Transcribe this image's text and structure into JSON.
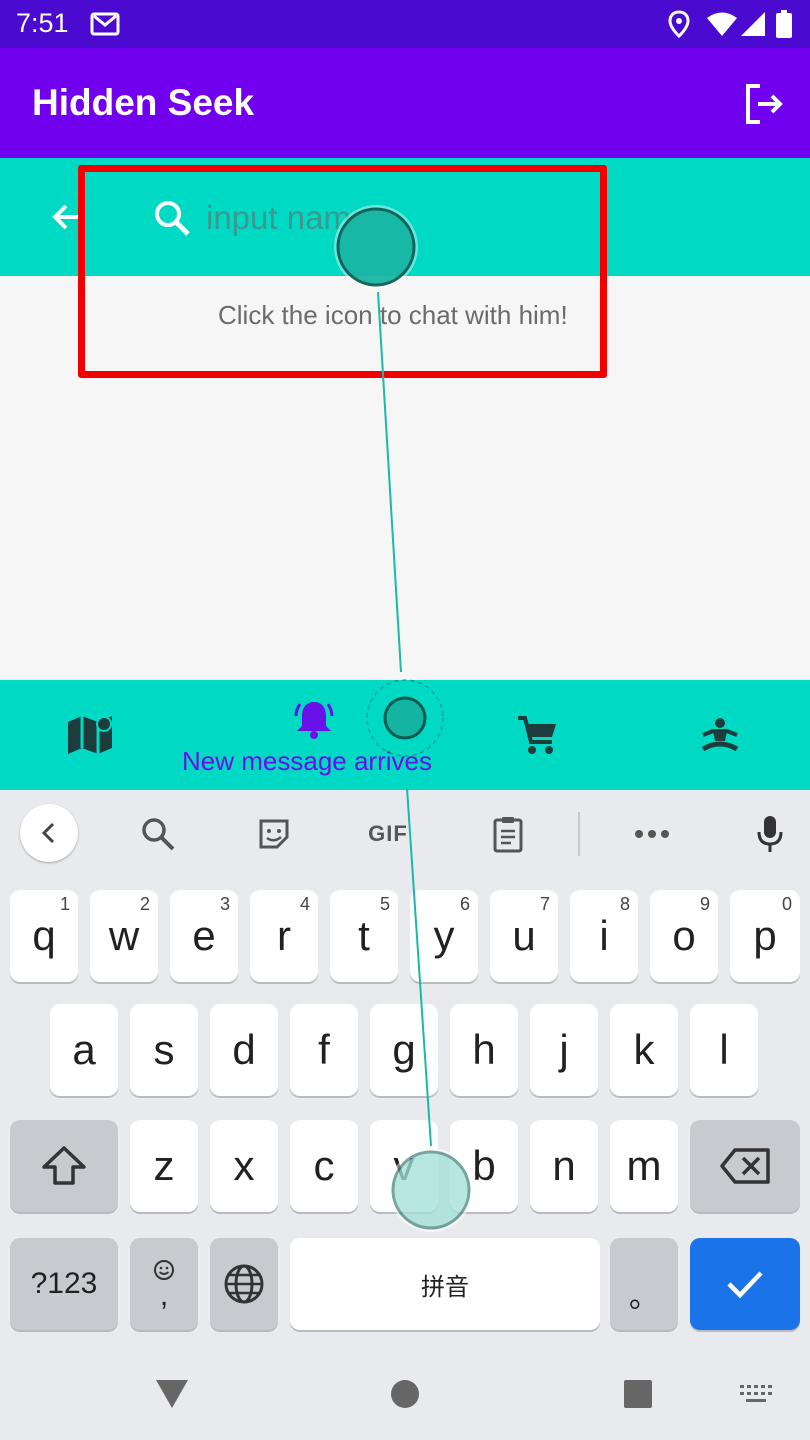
{
  "status_bar": {
    "time": "7:51",
    "icons": [
      "gmail-icon",
      "location-icon",
      "wifi-icon",
      "signal-icon",
      "battery-icon"
    ]
  },
  "app_bar": {
    "title": "Hidden Seek",
    "action_icon": "logout-icon"
  },
  "search": {
    "placeholder": "input name",
    "value": ""
  },
  "hint": "Click the icon to chat with him!",
  "bottom_nav": {
    "items": [
      {
        "icon": "map-icon",
        "selected": false
      },
      {
        "icon": "bell-icon",
        "selected": true,
        "label": "New message arrives"
      },
      {
        "icon": "cart-icon",
        "selected": false
      },
      {
        "icon": "meditation-icon",
        "selected": false
      }
    ]
  },
  "keyboard": {
    "toolbar": [
      "chevron-left-icon",
      "search-icon",
      "sticker-icon",
      "GIF",
      "clipboard-icon",
      "more-icon",
      "mic-icon"
    ],
    "rows": [
      [
        {
          "k": "q",
          "n": "1"
        },
        {
          "k": "w",
          "n": "2"
        },
        {
          "k": "e",
          "n": "3"
        },
        {
          "k": "r",
          "n": "4"
        },
        {
          "k": "t",
          "n": "5"
        },
        {
          "k": "y",
          "n": "6"
        },
        {
          "k": "u",
          "n": "7"
        },
        {
          "k": "i",
          "n": "8"
        },
        {
          "k": "o",
          "n": "9"
        },
        {
          "k": "p",
          "n": "0"
        }
      ],
      [
        "a",
        "s",
        "d",
        "f",
        "g",
        "h",
        "j",
        "k",
        "l"
      ],
      [
        "z",
        "x",
        "c",
        "v",
        "b",
        "n",
        "m"
      ]
    ],
    "symbols_label": "?123",
    "comma_label": ",",
    "space_label": "拼音",
    "period_label": "。"
  },
  "colors": {
    "status_bar": "#4a0ad0",
    "app_bar": "#7000ee",
    "teal": "#00d9c4",
    "accent_purple": "#6a10e8",
    "highlight_red": "#f20000",
    "enter_blue": "#1a73e8"
  }
}
